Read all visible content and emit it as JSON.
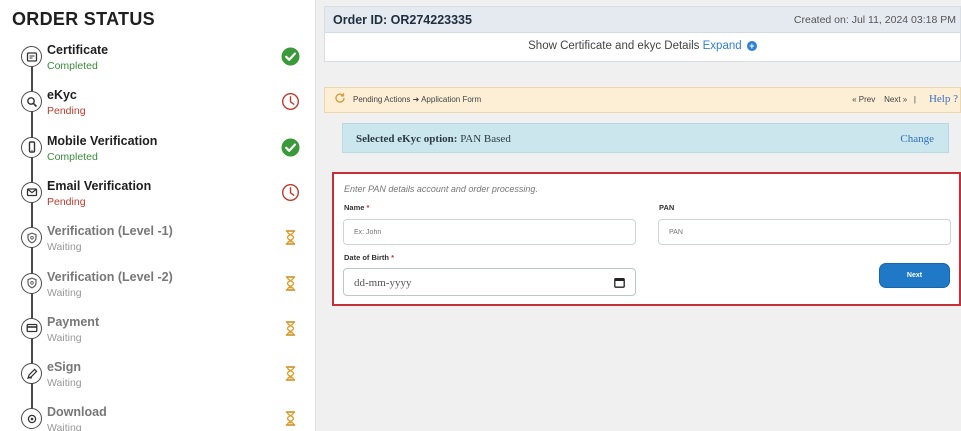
{
  "sidebar": {
    "title": "ORDER STATUS",
    "steps": [
      {
        "name": "Certificate",
        "status": "Completed",
        "state": "completed"
      },
      {
        "name": "eKyc",
        "status": "Pending",
        "state": "pending"
      },
      {
        "name": "Mobile Verification",
        "status": "Completed",
        "state": "completed"
      },
      {
        "name": "Email Verification",
        "status": "Pending",
        "state": "pending"
      },
      {
        "name": "Verification (Level -1)",
        "status": "Waiting",
        "state": "waiting"
      },
      {
        "name": "Verification (Level -2)",
        "status": "Waiting",
        "state": "waiting"
      },
      {
        "name": "Payment",
        "status": "Waiting",
        "state": "waiting"
      },
      {
        "name": "eSign",
        "status": "Waiting",
        "state": "waiting"
      },
      {
        "name": "Download",
        "status": "Waiting",
        "state": "waiting"
      }
    ]
  },
  "order": {
    "id_label": "Order ID: OR274223335",
    "created": "Created on: Jul 11, 2024 03:18 PM",
    "show_text": "Show Certificate and ekyc Details",
    "expand_label": "Expand"
  },
  "pending": {
    "text": "Pending Actions ➜ Application Form",
    "prev_label": "« Prev",
    "next_label": "Next »",
    "separator": "|",
    "help_label": "Help ?"
  },
  "ekyc": {
    "label_prefix": "Selected eKyc option:",
    "option": "PAN Based",
    "change_label": "Change"
  },
  "form": {
    "hint": "Enter PAN details account and order processing.",
    "name_label": "Name",
    "name_placeholder": "Ex: John",
    "pan_label": "PAN",
    "pan_placeholder": "PAN",
    "dob_label": "Date of Birth",
    "dob_placeholder": "dd-mm-yyyy",
    "required_mark": "*",
    "next_label": "Next"
  },
  "colors": {
    "completed": "#3a9a3a",
    "pending": "#c0392b",
    "waiting": "#e0a030",
    "accent": "#1f79c6",
    "form_border": "#c3303a"
  },
  "icons": {
    "step_icons": [
      "certificate-icon",
      "search-icon",
      "mobile-icon",
      "email-icon",
      "shield-icon",
      "shield-icon",
      "card-icon",
      "pen-icon",
      "download-icon"
    ],
    "completed": "check-circle-icon",
    "pending": "clock-icon",
    "waiting": "hourglass-icon"
  }
}
